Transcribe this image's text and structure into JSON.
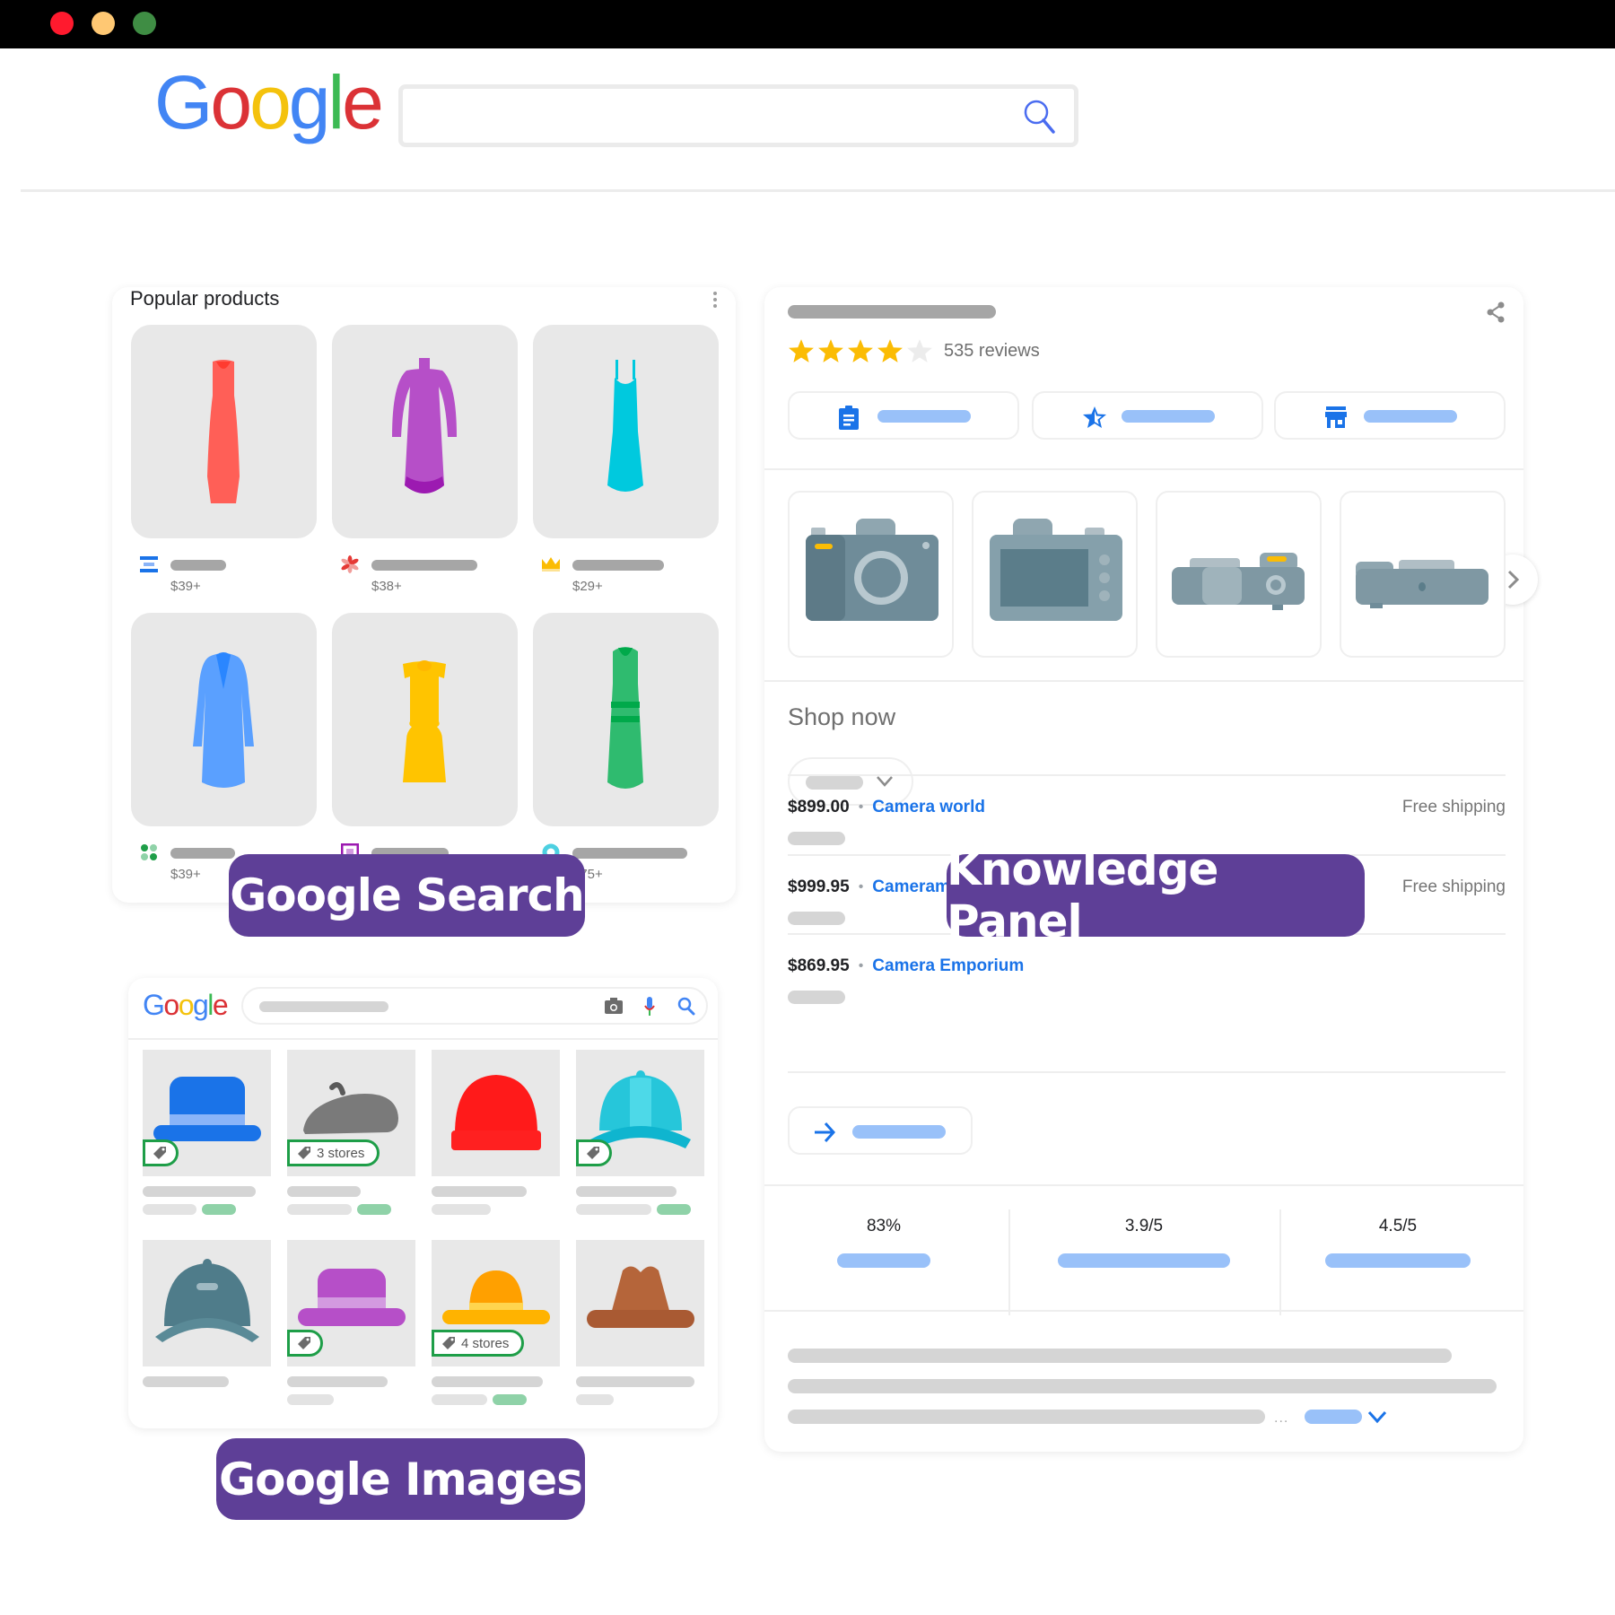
{
  "window": {
    "controls": [
      {
        "name": "close",
        "color": "#ff1a2e"
      },
      {
        "name": "minimize",
        "color": "#ffc873"
      },
      {
        "name": "maximize",
        "color": "#3f8d44"
      }
    ]
  },
  "header": {
    "logo_letters": [
      {
        "char": "G",
        "color": "#4285f4"
      },
      {
        "char": "o",
        "color": "#db3236"
      },
      {
        "char": "o",
        "color": "#f4c20d"
      },
      {
        "char": "g",
        "color": "#4285f4"
      },
      {
        "char": "l",
        "color": "#3cba54"
      },
      {
        "char": "e",
        "color": "#db3236"
      }
    ],
    "search_value": "",
    "search_icon": "search-icon"
  },
  "popular_products": {
    "title": "Popular products",
    "menu_icon": "more-vert-icon",
    "items": [
      {
        "product": "red-dress",
        "store_icon": "store-logo-blue-bars",
        "price": "$39+"
      },
      {
        "product": "purple-dress",
        "store_icon": "store-logo-red-flower",
        "price": "$38+"
      },
      {
        "product": "cyan-dress",
        "store_icon": "store-logo-yellow-crown",
        "price": "$29+"
      },
      {
        "product": "blue-coat-dress",
        "store_icon": "store-logo-green-dots",
        "price": "$39+"
      },
      {
        "product": "yellow-dress",
        "store_icon": "store-logo-purple-square",
        "price": ""
      },
      {
        "product": "green-dress",
        "store_icon": "store-logo-cyan-ring",
        "price": "$75+"
      }
    ]
  },
  "labels": {
    "google_search": "Google Search",
    "knowledge_panel": "Knowledge Panel",
    "google_images": "Google Images"
  },
  "knowledge_panel": {
    "rating_stars": 4,
    "rating_max": 5,
    "reviews": "535 reviews",
    "share_icon": "share-icon",
    "action_buttons": [
      {
        "icon": "clipboard-icon"
      },
      {
        "icon": "star-outline-icon"
      },
      {
        "icon": "store-icon"
      }
    ],
    "images": [
      "camera-front",
      "camera-back",
      "camera-top",
      "camera-bottom"
    ],
    "next_icon": "chevron-right-icon",
    "shop_now": "Shop now",
    "offers": [
      {
        "price": "$899.00",
        "store": "Camera world",
        "shipping": "Free shipping"
      },
      {
        "price": "$999.95",
        "store": "Cameramart - Modern Electronics",
        "shipping": "Free shipping"
      },
      {
        "price": "$869.95",
        "store": "Camera Emporium",
        "shipping": ""
      }
    ],
    "more_icon": "arrow-right-icon",
    "stats": [
      {
        "value": "83%"
      },
      {
        "value": "3.9/5"
      },
      {
        "value": "4.5/5"
      }
    ],
    "ellipsis": "...",
    "expand_icon": "chevron-down-icon"
  },
  "google_images": {
    "logo_letters": [
      {
        "char": "G",
        "color": "#4285f4"
      },
      {
        "char": "o",
        "color": "#db3236"
      },
      {
        "char": "o",
        "color": "#f4c20d"
      },
      {
        "char": "g",
        "color": "#4285f4"
      },
      {
        "char": "l",
        "color": "#3cba54"
      },
      {
        "char": "e",
        "color": "#db3236"
      }
    ],
    "items": [
      {
        "product": "blue-bowler-hat",
        "tag": ""
      },
      {
        "product": "gray-beret",
        "tag": "3 stores"
      },
      {
        "product": "red-beanie",
        "tag": null
      },
      {
        "product": "cyan-cap",
        "tag": ""
      },
      {
        "product": "teal-baseball-cap",
        "tag": null
      },
      {
        "product": "purple-hat",
        "tag": ""
      },
      {
        "product": "yellow-sun-hat",
        "tag": "4 stores"
      },
      {
        "product": "brown-fedora",
        "tag": null
      }
    ]
  },
  "colors": {
    "badge": "#5e3f97",
    "link_blue": "#1a73e8",
    "star": "#fbbc04",
    "placeholder_blue": "#99c1f9",
    "placeholder_gray": "#a6a6a6",
    "tag_green": "#1e9e48"
  }
}
